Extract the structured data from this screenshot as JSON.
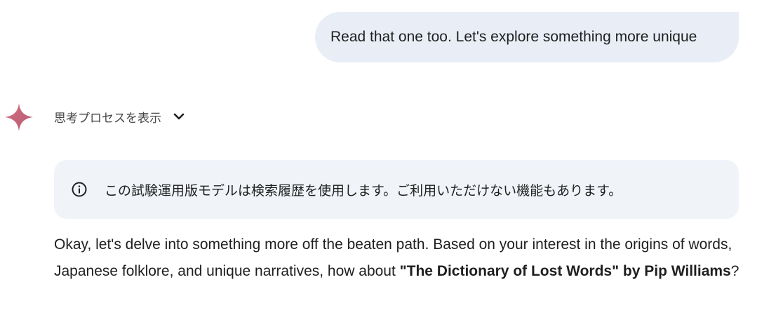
{
  "user_message": {
    "text": "Read that one too. Let's explore something more unique"
  },
  "assistant": {
    "icon": "gemini-sparkle-icon",
    "thinking_toggle": {
      "label": "思考プロセスを表示",
      "icon": "chevron-down-icon"
    },
    "notice": {
      "icon": "info-icon",
      "text": "この試験運用版モデルは検索履歴を使用します。ご利用いただけない機能もあります。"
    },
    "response": {
      "text_before": "Okay, let's delve into something more off the beaten path. Based on your interest in the origins of words, Japanese folklore, and unique narratives, how about ",
      "bold_text": "\"The Dictionary of Lost Words\" by Pip Williams",
      "text_after": "?"
    }
  },
  "colors": {
    "user_bubble_bg": "#e9eef6",
    "notice_bg": "#f0f4f9",
    "sparkle": "#c26679",
    "text": "#1f1f1f"
  }
}
